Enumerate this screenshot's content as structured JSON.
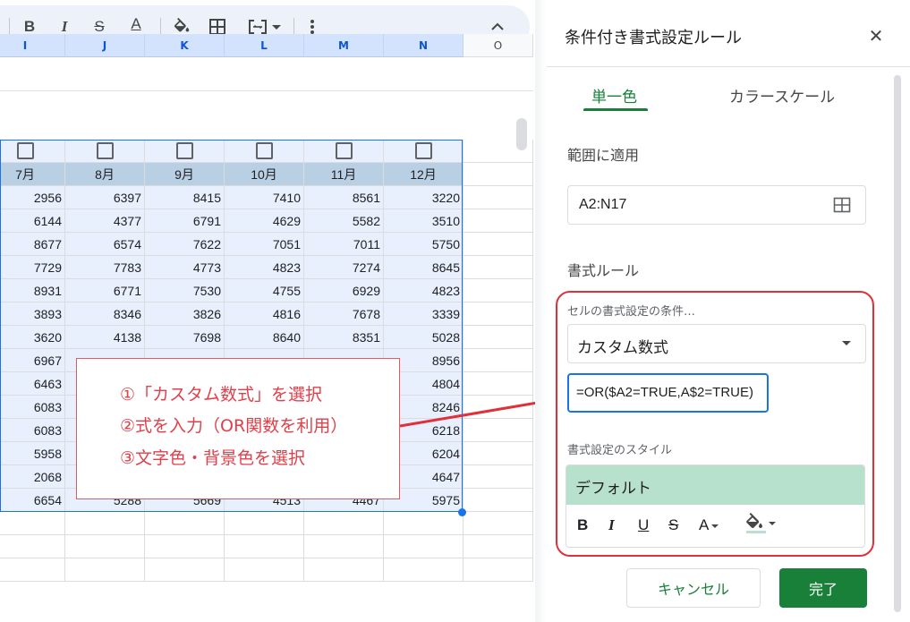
{
  "toolbar": {
    "bold_label": "B",
    "italic_label": "I",
    "strike_label": "S",
    "text_color_label": "A"
  },
  "sheet": {
    "columns": [
      "I",
      "J",
      "K",
      "L",
      "M",
      "N",
      "O"
    ],
    "month_headers": [
      "7月",
      "8月",
      "9月",
      "10月",
      "11月",
      "12月"
    ],
    "rows": [
      [
        "2956",
        "6397",
        "8415",
        "7410",
        "8561",
        "3220"
      ],
      [
        "6144",
        "4377",
        "6791",
        "4629",
        "5582",
        "3510"
      ],
      [
        "8677",
        "6574",
        "7622",
        "7051",
        "7011",
        "5750"
      ],
      [
        "7729",
        "7783",
        "4773",
        "4823",
        "7274",
        "8645"
      ],
      [
        "8931",
        "6771",
        "7530",
        "4755",
        "6929",
        "4823"
      ],
      [
        "3893",
        "8346",
        "3826",
        "4816",
        "7678",
        "3339"
      ],
      [
        "3620",
        "4138",
        "7698",
        "8640",
        "8351",
        "5028"
      ],
      [
        "6967",
        "",
        "",
        "",
        "",
        "8956"
      ],
      [
        "6463",
        "",
        "",
        "",
        "",
        "4804"
      ],
      [
        "6083",
        "",
        "",
        "",
        "",
        "8246"
      ],
      [
        "6083",
        "",
        "",
        "",
        "",
        "6218"
      ],
      [
        "5958",
        "",
        "",
        "",
        "",
        "6204"
      ],
      [
        "2068",
        "",
        "",
        "",
        "",
        "4647"
      ],
      [
        "6654",
        "5288",
        "5669",
        "4513",
        "4467",
        "5975"
      ]
    ]
  },
  "callout": {
    "line1": "①「カスタム数式」を選択",
    "line2": "②式を入力（OR関数を利用）",
    "line3": "③文字色・背景色を選択",
    "color": "#e0404a"
  },
  "panel": {
    "title": "条件付き書式設定ルール",
    "tabs": [
      {
        "label": "単一色"
      },
      {
        "label": "カラースケール"
      }
    ],
    "range_label": "範囲に適用",
    "range_value": "A2:N17",
    "rules_label": "書式ルール",
    "condition_label": "セルの書式設定の条件…",
    "condition_value": "カスタム数式",
    "formula_value": "=OR($A2=TRUE,A$2=TRUE)",
    "style_label": "書式設定のスタイル",
    "style_preview": "デフォルト",
    "format_buttons": {
      "bold": "B",
      "italic": "I",
      "underline": "U",
      "strike": "S",
      "text_color": "A"
    },
    "cancel_label": "キャンセル",
    "done_label": "完了",
    "accent_color": "#188038",
    "highlight_color": "#b7e1cd"
  }
}
